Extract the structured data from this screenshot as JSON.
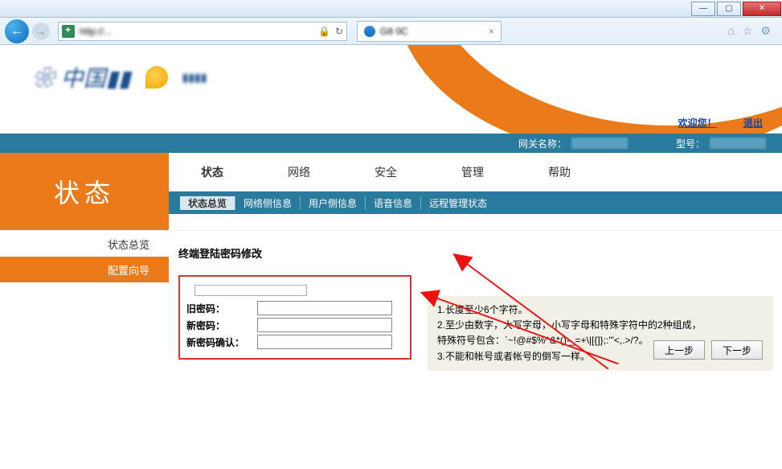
{
  "window": {
    "tab_title": "G8  0C",
    "address": "http://..."
  },
  "header": {
    "welcome": "欢迎您！",
    "logout": "退出"
  },
  "infobar": {
    "gateway_label": "网关名称：",
    "model_label": "型号："
  },
  "big_tab": "状态",
  "tabs": [
    "状态",
    "网络",
    "安全",
    "管理",
    "帮助"
  ],
  "subtabs": [
    "状态总览",
    "网络侧信息",
    "用户侧信息",
    "语音信息",
    "远程管理状态"
  ],
  "sidebar": {
    "items": [
      "状态总览",
      "配置向导"
    ],
    "active": 1
  },
  "section": {
    "title": "终端登陆密码修改",
    "form_title": "终端登陆密码修改",
    "old_pw": "旧密码：",
    "new_pw": "新密码：",
    "confirm_pw": "新密码确认："
  },
  "rules": {
    "r1": "1.长度至少6个字符。",
    "r2a": "2.至少由数字，大写字母，小写字母和特殊字符中的2种组成，",
    "r2b": "特殊符号包含：`~!@#$%^&*()-_=+\\|[{]};:'\"<,.>/?。",
    "r3": "3.不能和帐号或者帐号的倒写一样。"
  },
  "buttons": {
    "prev": "上一步",
    "next": "下一步"
  }
}
